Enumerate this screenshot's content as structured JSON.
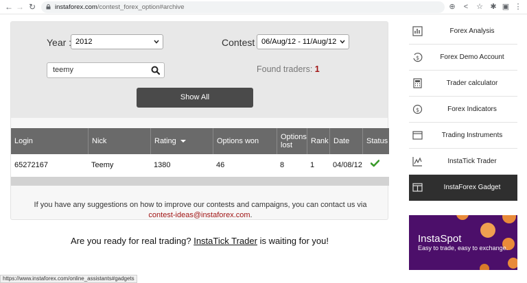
{
  "browser": {
    "url_host": "instaforex.com",
    "url_path": "/contest_forex_option#archive",
    "status_url": "https://www.instaforex.com/online_assistants#gadgets"
  },
  "filter": {
    "year_label": "Year :",
    "year_value": "2012",
    "contest_label": "Contest :",
    "contest_value": "06/Aug/12 - 11/Aug/12",
    "search_value": "teemy",
    "found_label": "Found traders:",
    "found_count": "1",
    "show_all_label": "Show All"
  },
  "table": {
    "headers": [
      "Login",
      "Nick",
      "Rating",
      "Options won",
      "Options lost",
      "Rank",
      "Date",
      "Status"
    ],
    "rows": [
      {
        "login": "65272167",
        "nick": "Teemy",
        "rating": "1380",
        "options_won": "46",
        "options_lost": "8",
        "rank": "1",
        "date": "04/08/12",
        "status": "check-icon"
      }
    ]
  },
  "suggestion": {
    "text": "If you have any suggestions on how to improve our contests and campaigns, you can contact us via",
    "email": "contest-ideas@instaforex.com",
    "suffix": "."
  },
  "cta": {
    "prefix": "Are you ready for real trading?",
    "link": "InstaTick Trader",
    "suffix": "is waiting for you!"
  },
  "sidebar": {
    "items": [
      {
        "label": "Forex Analysis",
        "icon": "analysis-icon"
      },
      {
        "label": "Forex Demo Account",
        "icon": "demo-account-icon"
      },
      {
        "label": "Trader calculator",
        "icon": "calculator-icon"
      },
      {
        "label": "Forex Indicators",
        "icon": "dollar-icon"
      },
      {
        "label": "Trading Instruments",
        "icon": "window-icon"
      },
      {
        "label": "InstaTick Trader",
        "icon": "chart-icon"
      },
      {
        "label": "InstaForex Gadget",
        "icon": "gadget-icon"
      }
    ]
  },
  "banner": {
    "title": "InstaSpot",
    "subtitle": "Easy to trade, easy to exchange."
  },
  "colors": {
    "accent_red": "#a01414",
    "table_header": "#6a6a6a",
    "button_dark": "#4a4a4a",
    "banner_purple": "#4c0f6a",
    "coin_orange": "#e98b3a",
    "check_green": "#3a9a2a"
  }
}
